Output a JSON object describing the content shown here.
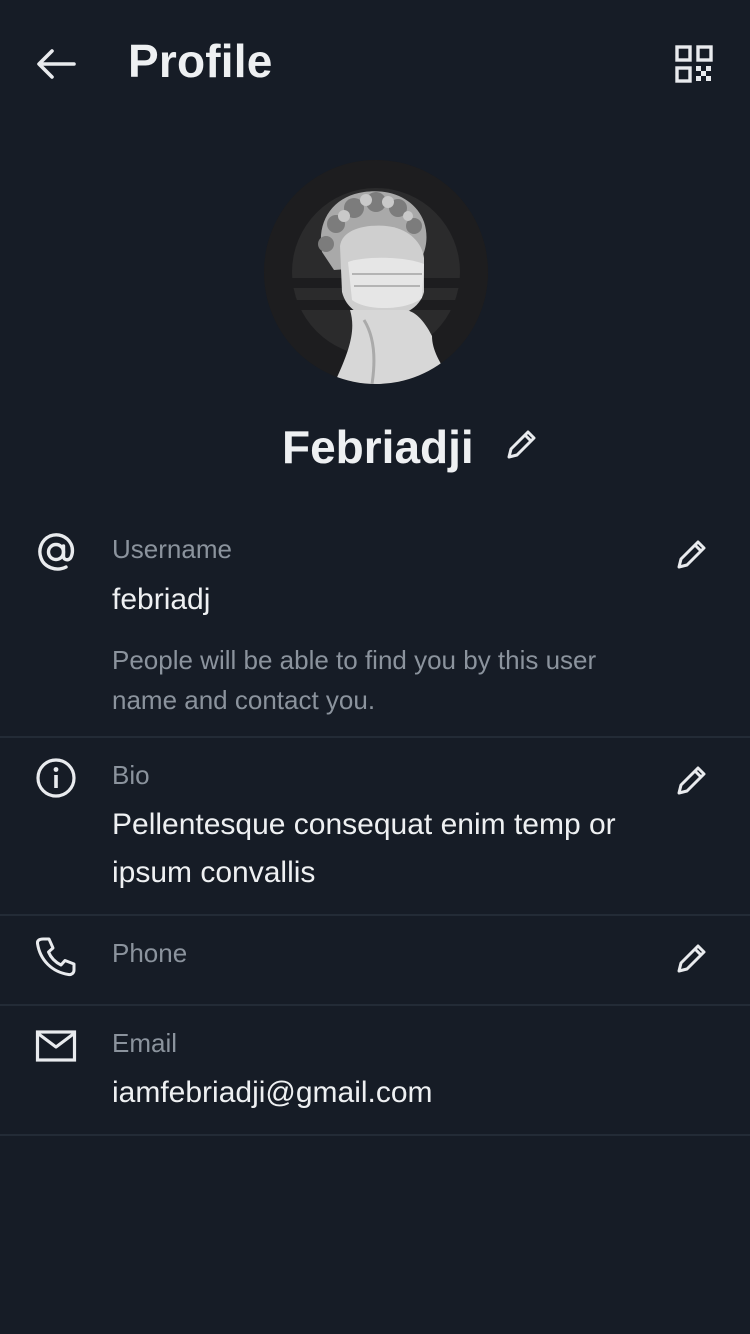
{
  "header": {
    "title": "Profile",
    "back_icon": "arrow-left-icon",
    "qr_icon": "qr-code-icon"
  },
  "profile": {
    "name": "Febriadji",
    "avatar_icon": "statue-masked-avatar"
  },
  "rows": {
    "username": {
      "icon": "at-sign-icon",
      "label": "Username",
      "value": "febriadj",
      "hint": "People will be able to find you by this user name and contact you."
    },
    "bio": {
      "icon": "info-icon",
      "label": "Bio",
      "value": "Pellentesque consequat enim temp or ipsum convallis"
    },
    "phone": {
      "icon": "phone-icon",
      "label": "Phone"
    },
    "email": {
      "icon": "mail-icon",
      "label": "Email",
      "value": "iamfebriadji@gmail.com"
    }
  },
  "colors": {
    "background": "#161c26",
    "text_primary": "#eef0f2",
    "text_secondary": "#8b939d",
    "divider": "#232b36"
  }
}
